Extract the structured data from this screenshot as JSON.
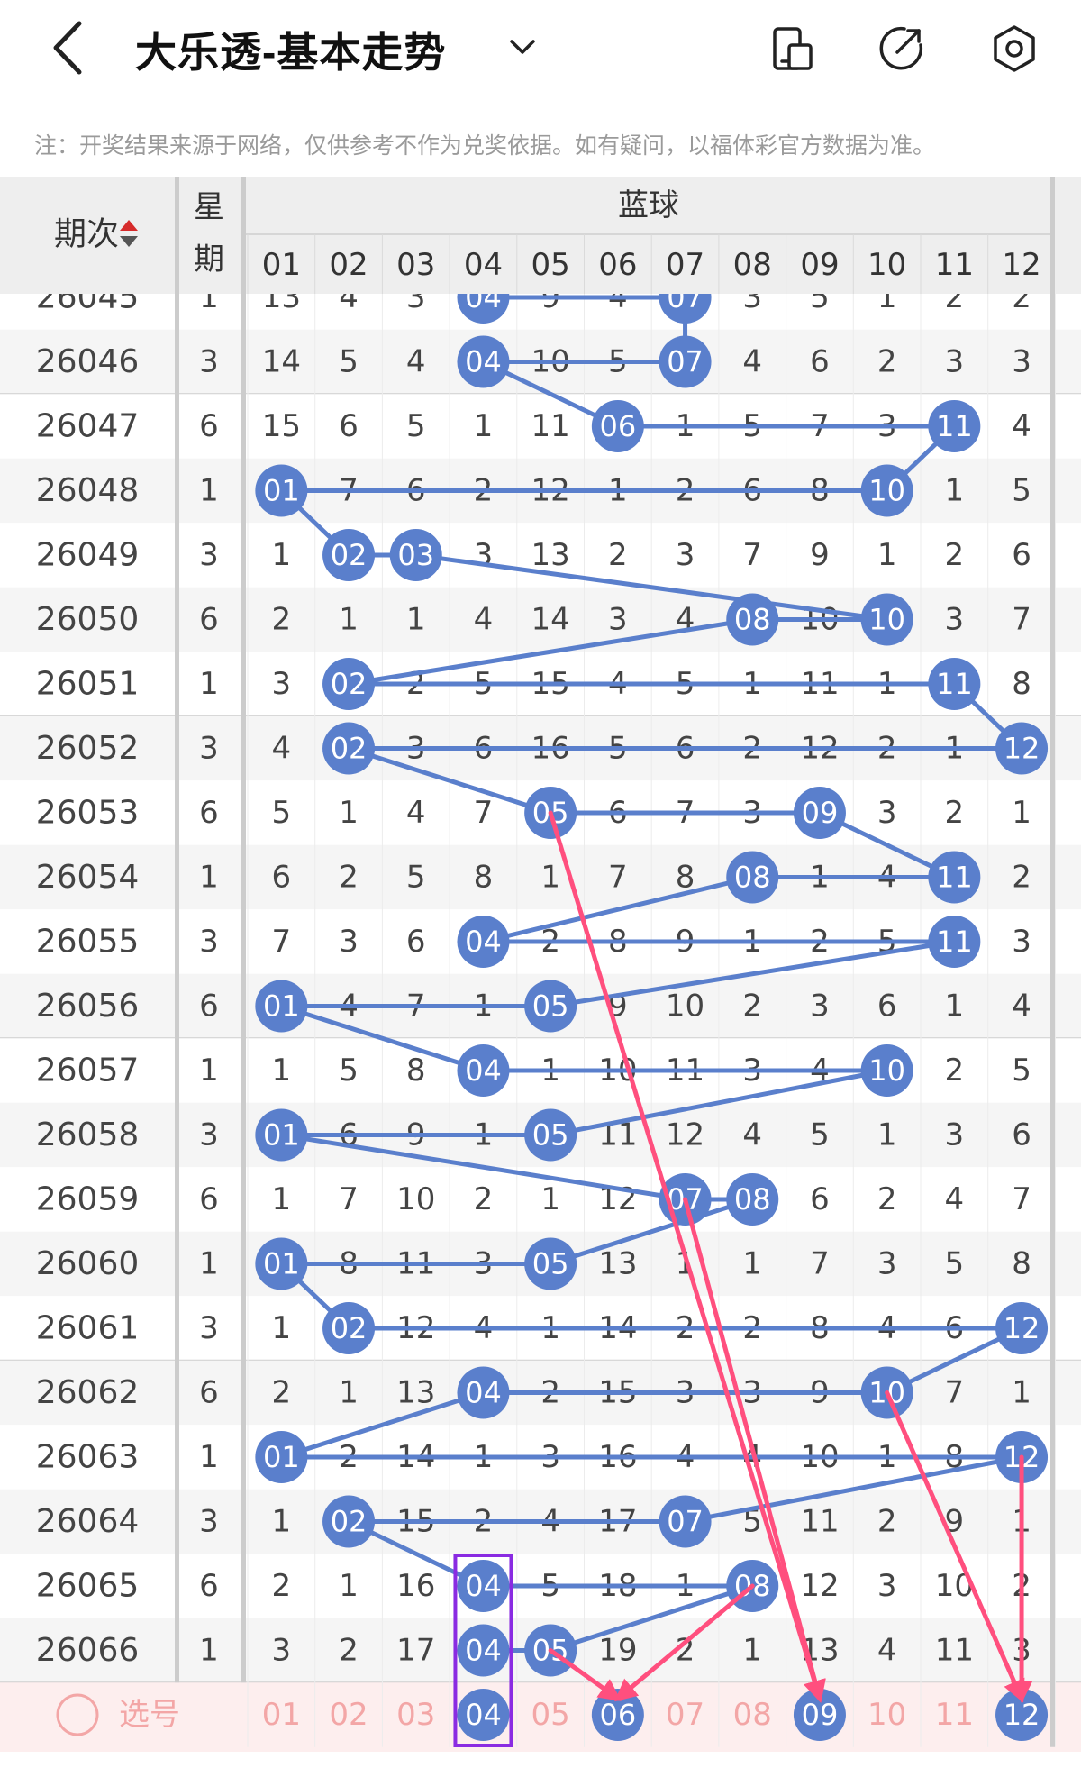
{
  "header": {
    "title": "大乐透-基本走势",
    "back_icon": "chevron-left-icon",
    "dropdown_icon": "chevron-down-icon",
    "icons": [
      "phone-layout-icon",
      "share-external-icon",
      "settings-hex-icon"
    ]
  },
  "notice": "注：开奖结果来源于网络，仅供参考不作为兑奖依据。如有疑问，以福体彩官方数据为准。",
  "table": {
    "col_period": "期次",
    "col_weekday_1": "星",
    "col_weekday_2": "期",
    "group_label": "蓝球",
    "numbers": [
      "01",
      "02",
      "03",
      "04",
      "05",
      "06",
      "07",
      "08",
      "09",
      "10",
      "11",
      "12"
    ],
    "rows": [
      {
        "period": "26045",
        "weekday": "1",
        "cells": [
          "13",
          "4",
          "3",
          "04",
          "9",
          "4",
          "07",
          "3",
          "5",
          "1",
          "2",
          "2"
        ],
        "hits": [
          4,
          7
        ]
      },
      {
        "period": "26046",
        "weekday": "3",
        "cells": [
          "14",
          "5",
          "4",
          "04",
          "10",
          "5",
          "07",
          "4",
          "6",
          "2",
          "3",
          "3"
        ],
        "hits": [
          4,
          7
        ]
      },
      {
        "period": "26047",
        "weekday": "6",
        "cells": [
          "15",
          "6",
          "5",
          "1",
          "11",
          "06",
          "1",
          "5",
          "7",
          "3",
          "11",
          "4"
        ],
        "hits": [
          6,
          11
        ]
      },
      {
        "period": "26048",
        "weekday": "1",
        "cells": [
          "01",
          "7",
          "6",
          "2",
          "12",
          "1",
          "2",
          "6",
          "8",
          "10",
          "1",
          "5"
        ],
        "hits": [
          1,
          10
        ]
      },
      {
        "period": "26049",
        "weekday": "3",
        "cells": [
          "1",
          "02",
          "03",
          "3",
          "13",
          "2",
          "3",
          "7",
          "9",
          "1",
          "2",
          "6"
        ],
        "hits": [
          2,
          3
        ]
      },
      {
        "period": "26050",
        "weekday": "6",
        "cells": [
          "2",
          "1",
          "1",
          "4",
          "14",
          "3",
          "4",
          "08",
          "10",
          "10",
          "3",
          "7"
        ],
        "hits": [
          8,
          10
        ]
      },
      {
        "period": "26051",
        "weekday": "1",
        "cells": [
          "3",
          "02",
          "2",
          "5",
          "15",
          "4",
          "5",
          "1",
          "11",
          "1",
          "11",
          "8"
        ],
        "hits": [
          2,
          11
        ]
      },
      {
        "period": "26052",
        "weekday": "3",
        "cells": [
          "4",
          "02",
          "3",
          "6",
          "16",
          "5",
          "6",
          "2",
          "12",
          "2",
          "1",
          "12"
        ],
        "hits": [
          2,
          12
        ]
      },
      {
        "period": "26053",
        "weekday": "6",
        "cells": [
          "5",
          "1",
          "4",
          "7",
          "05",
          "6",
          "7",
          "3",
          "09",
          "3",
          "2",
          "1"
        ],
        "hits": [
          5,
          9
        ]
      },
      {
        "period": "26054",
        "weekday": "1",
        "cells": [
          "6",
          "2",
          "5",
          "8",
          "1",
          "7",
          "8",
          "08",
          "1",
          "4",
          "11",
          "2"
        ],
        "hits": [
          8,
          11
        ]
      },
      {
        "period": "26055",
        "weekday": "3",
        "cells": [
          "7",
          "3",
          "6",
          "04",
          "2",
          "8",
          "9",
          "1",
          "2",
          "5",
          "11",
          "3"
        ],
        "hits": [
          4,
          11
        ]
      },
      {
        "period": "26056",
        "weekday": "6",
        "cells": [
          "01",
          "4",
          "7",
          "1",
          "05",
          "9",
          "10",
          "2",
          "3",
          "6",
          "1",
          "4"
        ],
        "hits": [
          1,
          5
        ]
      },
      {
        "period": "26057",
        "weekday": "1",
        "cells": [
          "1",
          "5",
          "8",
          "04",
          "1",
          "10",
          "11",
          "3",
          "4",
          "10",
          "2",
          "5"
        ],
        "hits": [
          4,
          10
        ]
      },
      {
        "period": "26058",
        "weekday": "3",
        "cells": [
          "01",
          "6",
          "9",
          "1",
          "05",
          "11",
          "12",
          "4",
          "5",
          "1",
          "3",
          "6"
        ],
        "hits": [
          1,
          5
        ]
      },
      {
        "period": "26059",
        "weekday": "6",
        "cells": [
          "1",
          "7",
          "10",
          "2",
          "1",
          "12",
          "07",
          "08",
          "6",
          "2",
          "4",
          "7"
        ],
        "hits": [
          7,
          8
        ]
      },
      {
        "period": "26060",
        "weekday": "1",
        "cells": [
          "01",
          "8",
          "11",
          "3",
          "05",
          "13",
          "1",
          "1",
          "7",
          "3",
          "5",
          "8"
        ],
        "hits": [
          1,
          5
        ]
      },
      {
        "period": "26061",
        "weekday": "3",
        "cells": [
          "1",
          "02",
          "12",
          "4",
          "1",
          "14",
          "2",
          "2",
          "8",
          "4",
          "6",
          "12"
        ],
        "hits": [
          2,
          12
        ]
      },
      {
        "period": "26062",
        "weekday": "6",
        "cells": [
          "2",
          "1",
          "13",
          "04",
          "2",
          "15",
          "3",
          "3",
          "9",
          "10",
          "7",
          "1"
        ],
        "hits": [
          4,
          10
        ]
      },
      {
        "period": "26063",
        "weekday": "1",
        "cells": [
          "01",
          "2",
          "14",
          "1",
          "3",
          "16",
          "4",
          "4",
          "10",
          "1",
          "8",
          "12"
        ],
        "hits": [
          1,
          12
        ]
      },
      {
        "period": "26064",
        "weekday": "3",
        "cells": [
          "1",
          "02",
          "15",
          "2",
          "4",
          "17",
          "07",
          "5",
          "11",
          "2",
          "9",
          "1"
        ],
        "hits": [
          2,
          7
        ]
      },
      {
        "period": "26065",
        "weekday": "6",
        "cells": [
          "2",
          "1",
          "16",
          "04",
          "5",
          "18",
          "1",
          "08",
          "12",
          "3",
          "10",
          "2"
        ],
        "hits": [
          4,
          8
        ]
      },
      {
        "period": "26066",
        "weekday": "1",
        "cells": [
          "3",
          "2",
          "17",
          "04",
          "05",
          "19",
          "2",
          "1",
          "13",
          "4",
          "11",
          "3"
        ],
        "hits": [
          4,
          5
        ]
      }
    ],
    "select_row": {
      "label": "选号",
      "radio_icon": "radio-circle-icon",
      "selected": [
        4,
        6,
        9,
        12
      ]
    }
  },
  "colors": {
    "ball": "#5a7fcc",
    "ball_text": "#ffffff",
    "link_line": "#5a7fcc",
    "arrow": "#ff4f7e",
    "select_row_bg": "#fdeeee",
    "select_num_text": "#f3a6a6",
    "highlight_box": "#8a2be2",
    "header_bg": "#eeeeee",
    "row_alt_bg": "#f5f5f5",
    "cell_text": "#444444"
  },
  "annotations": {
    "arrows": [
      {
        "from_row": "26053",
        "from_col": 5,
        "to": "select",
        "to_col": 9
      },
      {
        "from_row": "26059",
        "from_col": 7,
        "to": "select",
        "to_col": 9
      },
      {
        "from_row": "26065",
        "from_col": 8,
        "to": "select",
        "to_col": 6
      },
      {
        "from_row": "26066",
        "from_col": 5,
        "to": "select",
        "to_col": 6
      },
      {
        "from_row": "26062",
        "from_col": 10,
        "to": "select",
        "to_col": 12
      },
      {
        "from_row": "26063",
        "from_col": 12,
        "to": "select",
        "to_col": 12
      }
    ],
    "highlight_box_col": 4,
    "highlight_box_from_row": "26065"
  }
}
